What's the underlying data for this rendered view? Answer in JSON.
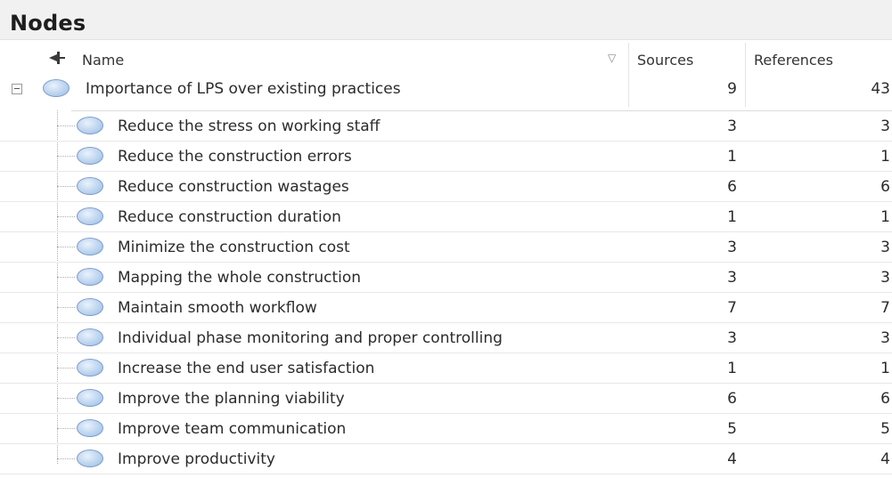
{
  "panel": {
    "title": "Nodes"
  },
  "columns": {
    "name": "Name",
    "sources": "Sources",
    "references": "References",
    "pin_icon": "pin-icon",
    "sort_icon": "sort-filter-icon"
  },
  "parent": {
    "name": "Importance of LPS over existing practices",
    "sources": "9",
    "references": "43",
    "expanded": true
  },
  "children": [
    {
      "name": "Reduce the stress on working staff",
      "sources": "3",
      "references": "3"
    },
    {
      "name": "Reduce the construction errors",
      "sources": "1",
      "references": "1"
    },
    {
      "name": "Reduce construction wastages",
      "sources": "6",
      "references": "6"
    },
    {
      "name": "Reduce construction duration",
      "sources": "1",
      "references": "1"
    },
    {
      "name": "Minimize the construction cost",
      "sources": "3",
      "references": "3"
    },
    {
      "name": "Mapping the whole construction",
      "sources": "3",
      "references": "3"
    },
    {
      "name": "Maintain smooth workflow",
      "sources": "7",
      "references": "7"
    },
    {
      "name": "Individual phase monitoring and proper controlling",
      "sources": "3",
      "references": "3"
    },
    {
      "name": "Increase the end user satisfaction",
      "sources": "1",
      "references": "1"
    },
    {
      "name": "Improve the planning viability",
      "sources": "6",
      "references": "6"
    },
    {
      "name": "Improve team communication",
      "sources": "5",
      "references": "5"
    },
    {
      "name": "Improve productivity",
      "sources": "4",
      "references": "4"
    }
  ],
  "colors": {
    "node_fill": "#bcd4ef",
    "node_border": "#7e9ccb",
    "title_bg": "#f1f1f1"
  }
}
